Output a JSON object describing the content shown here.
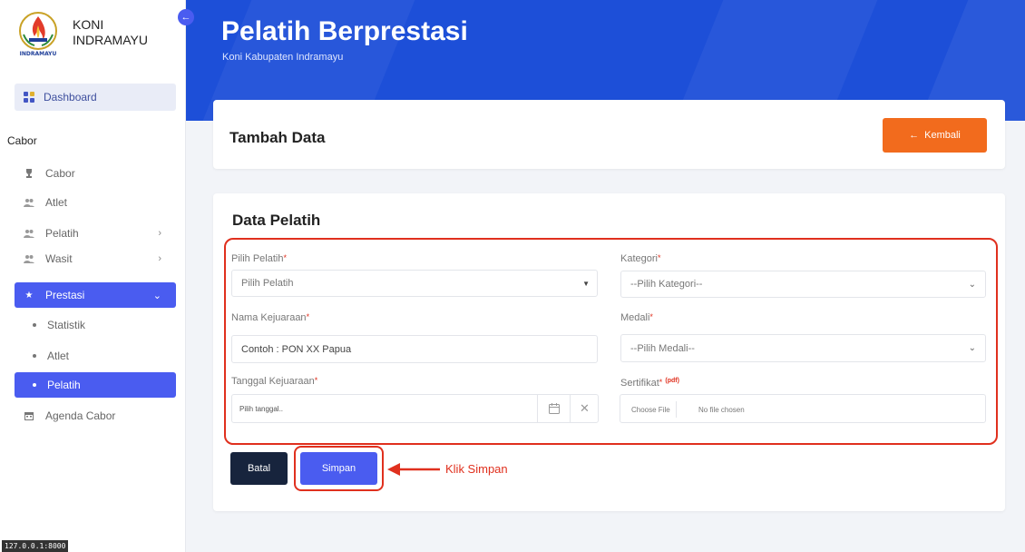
{
  "sidebar": {
    "brand_line1": "KONI",
    "brand_line2": "INDRAMAYU",
    "logo_text": "INDRAMAYU",
    "collapse_icon": "arrow-left-icon",
    "dashboard_label": "Dashboard",
    "section_label": "Cabor",
    "items": [
      {
        "label": "Cabor",
        "icon": "trophy-icon"
      },
      {
        "label": "Atlet",
        "icon": "users-icon"
      },
      {
        "label": "Pelatih",
        "icon": "users-icon",
        "has_chevron": true
      },
      {
        "label": "Wasit",
        "icon": "users-icon",
        "has_chevron": true
      },
      {
        "label": "Prestasi",
        "icon": "star-icon",
        "active": true,
        "expanded": true
      }
    ],
    "sub_items": [
      {
        "label": "Statistik"
      },
      {
        "label": "Atlet"
      },
      {
        "label": "Pelatih",
        "active": true
      }
    ],
    "agenda_label": "Agenda Cabor"
  },
  "header": {
    "title": "Pelatih Berprestasi",
    "subtitle": "Koni Kabupaten Indramayu"
  },
  "top_card": {
    "title": "Tambah Data",
    "back_label": "Kembali"
  },
  "form": {
    "title": "Data Pelatih",
    "pilih_pelatih_label": "Pilih Pelatih",
    "pilih_pelatih_value": "Pilih Pelatih",
    "kategori_label": "Kategori",
    "kategori_value": "--Pilih Kategori--",
    "nama_kejuaraan_label": "Nama Kejuaraan",
    "nama_kejuaraan_value": "Contoh : PON XX Papua",
    "medali_label": "Medali",
    "medali_value": "--Pilih Medali--",
    "tanggal_label": "Tanggal Kejuaraan",
    "tanggal_placeholder": "Pilih tanggal..",
    "sertifikat_label": "Sertifikat",
    "sertifikat_note": "(pdf)",
    "choose_file_label": "Choose File",
    "no_file_label": "No file chosen",
    "required_mark": "*",
    "batal_label": "Batal",
    "simpan_label": "Simpan",
    "annotation": "Klik Simpan"
  },
  "status_url": "127.0.0.1:8000",
  "colors": {
    "primary": "#4a5cf0",
    "header_bg": "#1d4fd8",
    "orange": "#f26b1d",
    "dark": "#17243d",
    "annotation_red": "#e0301e"
  }
}
